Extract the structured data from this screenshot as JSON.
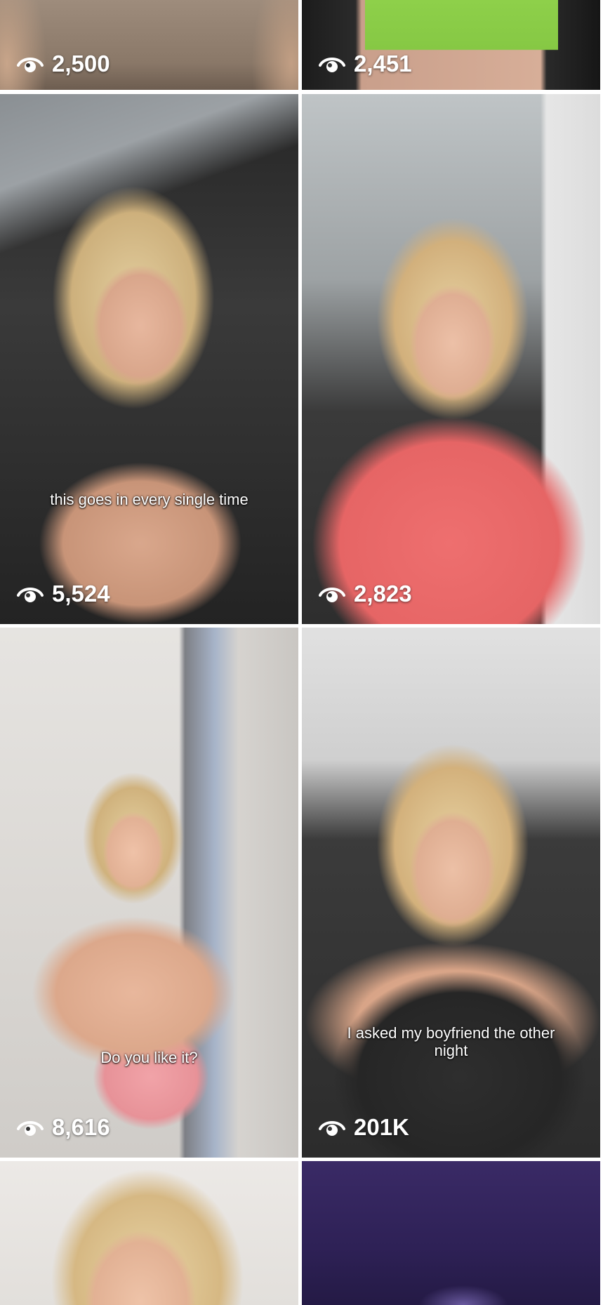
{
  "grid": {
    "tiles": [
      {
        "views": "2,500",
        "caption": ""
      },
      {
        "views": "2,451",
        "caption": ""
      },
      {
        "views": "5,524",
        "caption": "this goes in every single time"
      },
      {
        "views": "2,823",
        "caption": ""
      },
      {
        "views": "8,616",
        "caption": "Do you like it?"
      },
      {
        "views": "201K",
        "caption": "I asked my boyfriend the other night"
      },
      {
        "views": "",
        "caption": ""
      },
      {
        "views": "",
        "caption": ""
      }
    ]
  },
  "icons": {
    "views": "eye-icon"
  },
  "colors": {
    "background": "#ffffff",
    "overlay_text": "#ffffff"
  }
}
